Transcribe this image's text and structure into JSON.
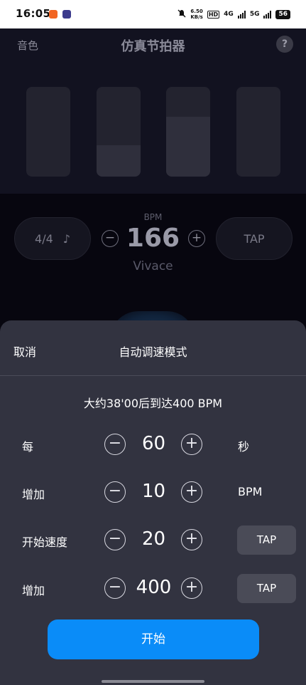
{
  "status_bar": {
    "time": "16:05",
    "net_speed_value": "6.50",
    "net_speed_unit": "KB/s",
    "hd_label": "HD",
    "sim1": "4G",
    "sim2": "5G",
    "battery": "56"
  },
  "background_app": {
    "left_label": "音色",
    "title": "仿真节拍器",
    "help_icon": "?",
    "beats": [
      {
        "fill": 0
      },
      {
        "fill": 0.35
      },
      {
        "fill": 0.67
      },
      {
        "fill": 0
      }
    ],
    "time_signature": "4/4",
    "note_icon": "♪",
    "minus_symbol": "−",
    "plus_symbol": "+",
    "bpm_label": "BPM",
    "bpm_value": "166",
    "tempo_name": "Vivace",
    "tap_label": "TAP"
  },
  "sheet": {
    "cancel_label": "取消",
    "title": "自动调速模式",
    "info_text": "大约38'00后到达400 BPM",
    "minus_symbol": "−",
    "plus_symbol": "+",
    "rows": [
      {
        "label": "每",
        "value": "60",
        "unit": "秒"
      },
      {
        "label": "增加",
        "value": "10",
        "unit": "BPM"
      },
      {
        "label": "开始速度",
        "value": "20",
        "tap": "TAP"
      },
      {
        "label": "增加",
        "value": "400",
        "tap": "TAP"
      }
    ],
    "start_label": "开始"
  },
  "colors": {
    "accent": "#0a8cf8",
    "sheet_bg": "#323340",
    "background": "#07060f"
  }
}
